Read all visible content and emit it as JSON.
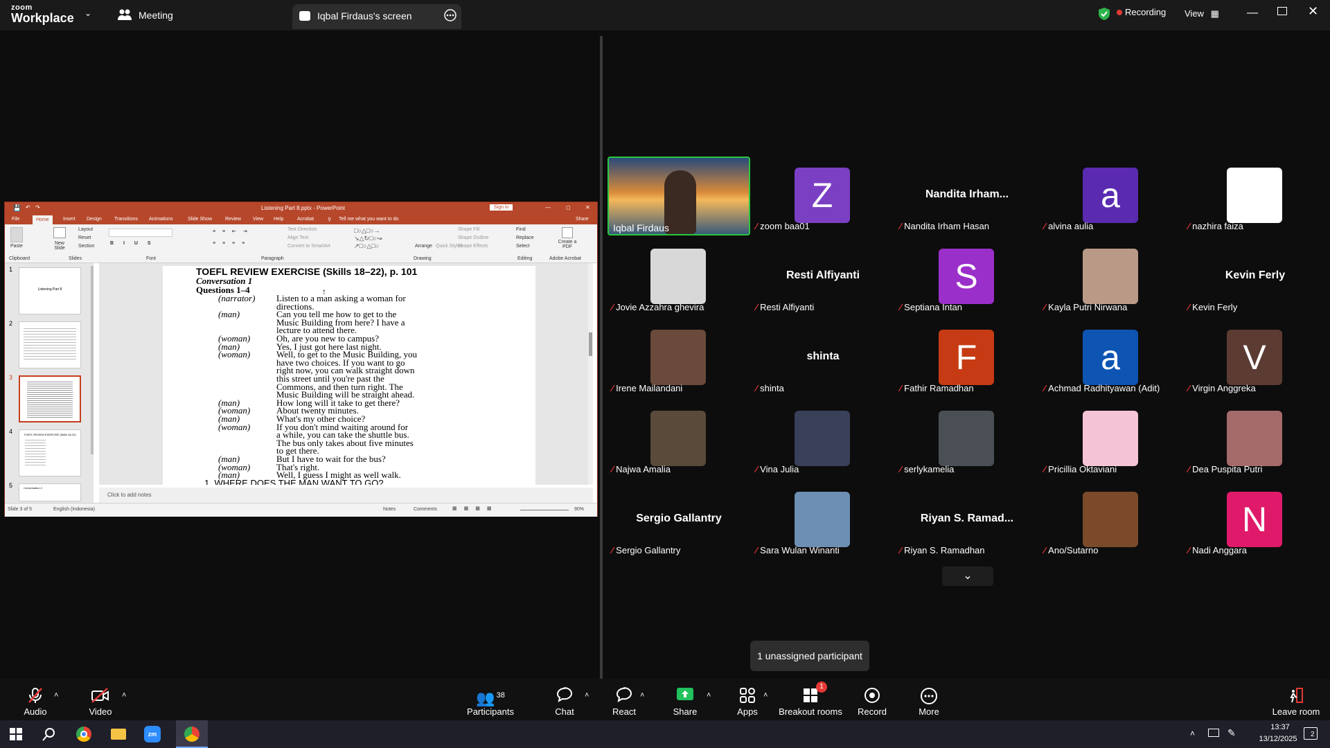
{
  "header": {
    "logo_top": "zoom",
    "logo_bottom": "Workplace",
    "meeting_label": "Meeting",
    "share_tab_label": "Iqbal Firdaus's screen",
    "recording_label": "Recording",
    "view_label": "View",
    "recording_color": "#e53935",
    "shield_color": "#2db34a"
  },
  "ppt": {
    "title": "Listening Part 8.pptx - PowerPoint",
    "sign_in": "Sign in",
    "tabs": [
      "File",
      "Home",
      "Insert",
      "Design",
      "Transitions",
      "Animations",
      "Slide Show",
      "Review",
      "View",
      "Help",
      "Acrobat",
      "Tell me what you want to do"
    ],
    "share": "Share",
    "ribbon": {
      "paste": "Paste",
      "layout": "Layout",
      "reset": "Reset",
      "new_slide": "New Slide",
      "section": "Section",
      "find": "Find",
      "replace": "Replace",
      "select": "Select",
      "create_pdf": "Create a PDF",
      "text_direction": "Text Direction",
      "align_text": "Align Text",
      "convert_smartart": "Convert to SmartArt",
      "shape_fill": "Shape Fill",
      "shape_outline": "Shape Outline",
      "shape_effects": "Shape Effects",
      "arrange": "Arrange",
      "quick_styles": "Quick Styles",
      "groups": [
        "Clipboard",
        "Slides",
        "Font",
        "Paragraph",
        "Drawing",
        "Editing",
        "Adobe Acrobat"
      ]
    },
    "thumbs": [
      {
        "num": "1",
        "text": "Listening Part 8"
      },
      {
        "num": "2",
        "text": ""
      },
      {
        "num": "3",
        "text": ""
      },
      {
        "num": "4",
        "text": "TOEFL REVIEW EXERCISE (Skills 18-22)"
      },
      {
        "num": "5",
        "text": "Conversation 2"
      }
    ],
    "slide": {
      "heading": "TOEFL REVIEW EXERCISE (Skills 18–22), p. 101",
      "sub1": "Conversation 1",
      "sub2": "Questions 1–4",
      "lines": [
        {
          "speaker": "(narrator)",
          "text": "Listen to a man asking a woman for"
        },
        {
          "speaker": "",
          "text": "directions."
        },
        {
          "speaker": "(man)",
          "text": "Can you tell me how to get to the"
        },
        {
          "speaker": "",
          "text": "Music Building from here? I have a"
        },
        {
          "speaker": "",
          "text": "lecture to attend there."
        },
        {
          "speaker": "(woman)",
          "text": "Oh, are you new to campus?"
        },
        {
          "speaker": "(man)",
          "text": "Yes, I just got here last night."
        },
        {
          "speaker": "(woman)",
          "text": "Well, to get to the Music Building, you"
        },
        {
          "speaker": "",
          "text": "have two choices. If you want to go"
        },
        {
          "speaker": "",
          "text": "right now, you can walk straight down"
        },
        {
          "speaker": "",
          "text": "this street until you're past the"
        },
        {
          "speaker": "",
          "text": "Commons, and then turn right. The"
        },
        {
          "speaker": "",
          "text": "Music Building will be straight ahead."
        },
        {
          "speaker": "(man)",
          "text": "How long will it take to get there?"
        },
        {
          "speaker": "(woman)",
          "text": "About twenty minutes."
        },
        {
          "speaker": "(man)",
          "text": "What's my other choice?"
        },
        {
          "speaker": "(woman)",
          "text": "If you don't mind waiting around for"
        },
        {
          "speaker": "",
          "text": "a while, you can take the shuttle bus."
        },
        {
          "speaker": "",
          "text": "The bus only takes about five minutes"
        },
        {
          "speaker": "",
          "text": "to get there."
        },
        {
          "speaker": "(man)",
          "text": "But I have to wait for the bus?"
        },
        {
          "speaker": "(woman)",
          "text": "That's right."
        },
        {
          "speaker": "(man)",
          "text": "Well, I guess I might as well walk."
        },
        {
          "speaker": "",
          "text": "1. WHERE DOES THE MAN WANT TO GO?"
        }
      ]
    },
    "notes_placeholder": "Click to add notes",
    "status": {
      "slide_count": "Slide 3 of 5",
      "language": "English (Indonesia)",
      "notes": "Notes",
      "comments": "Comments",
      "zoom": "90%"
    }
  },
  "gallery": {
    "participants": [
      {
        "name": "Iqbal Firdaus",
        "type": "video",
        "muted": false,
        "active": true
      },
      {
        "name": "zoom baa01",
        "type": "letter",
        "letter": "Z",
        "color": "#7b3fc4",
        "muted": true
      },
      {
        "name": "Nandita Irham Hasan",
        "type": "name",
        "big": "Nandita  Irham...",
        "muted": true
      },
      {
        "name": "alvina aulia",
        "type": "letter",
        "letter": "a",
        "color": "#5a2bb0",
        "muted": true
      },
      {
        "name": "nazhira faiza",
        "type": "blank",
        "color": "#ffffff",
        "muted": true
      },
      {
        "name": "Jovie Azzahra ghevira",
        "type": "photo",
        "color": "#d8d8d8",
        "muted": true
      },
      {
        "name": "Resti Alfiyanti",
        "type": "name",
        "big": "Resti Alfiyanti",
        "muted": true
      },
      {
        "name": "Septiana Intan",
        "type": "letter",
        "letter": "S",
        "color": "#9b2fc9",
        "muted": true
      },
      {
        "name": "Kayla Putri Nirwana",
        "type": "photo",
        "color": "#b99a86",
        "muted": true
      },
      {
        "name": "Kevin Ferly",
        "type": "name",
        "big": "Kevin Ferly",
        "muted": true
      },
      {
        "name": "Irene Mailandani",
        "type": "photo",
        "color": "#6a4a3a",
        "muted": true
      },
      {
        "name": "shinta",
        "type": "name",
        "big": "shinta",
        "muted": true
      },
      {
        "name": "Fathir Ramadhan",
        "type": "letter",
        "letter": "F",
        "color": "#c63b13",
        "muted": true
      },
      {
        "name": "Achmad Radhityawan (Adit)",
        "type": "letter",
        "letter": "a",
        "color": "#0e55b3",
        "muted": true
      },
      {
        "name": "Virgin Anggreka",
        "type": "letter",
        "letter": "V",
        "color": "#5b3b32",
        "muted": true
      },
      {
        "name": "Najwa Amalia",
        "type": "photo",
        "color": "#5a4a3a",
        "muted": true
      },
      {
        "name": "Vina Julia",
        "type": "photo",
        "color": "#3a3f5a",
        "muted": true
      },
      {
        "name": "serlykamelia",
        "type": "photo",
        "color": "#4a4f55",
        "muted": true
      },
      {
        "name": "Pricillia Oktaviani",
        "type": "photo",
        "color": "#f3c4d6",
        "muted": true
      },
      {
        "name": "Dea Puspita Putri",
        "type": "photo",
        "color": "#a56a6a",
        "muted": true
      },
      {
        "name": "Sergio Gallantry",
        "type": "name",
        "big": "Sergio Gallantry",
        "muted": true
      },
      {
        "name": "Sara Wulan Winanti",
        "type": "photo",
        "color": "#6c8fb3",
        "muted": true
      },
      {
        "name": "Riyan S. Ramadhan",
        "type": "name",
        "big": "Riyan S. Ramad...",
        "muted": true
      },
      {
        "name": "Ano/Sutarno",
        "type": "photo",
        "color": "#7a4a2a",
        "muted": true
      },
      {
        "name": "Nadi Anggara",
        "type": "letter",
        "letter": "N",
        "color": "#e01a6a",
        "muted": true
      }
    ],
    "unassigned": "1 unassigned participant"
  },
  "toolbar": {
    "audio": "Audio",
    "video": "Video",
    "participants": "Participants",
    "participants_count": "38",
    "chat": "Chat",
    "react": "React",
    "share": "Share",
    "apps": "Apps",
    "breakout": "Breakout rooms",
    "breakout_badge": "1",
    "record": "Record",
    "more": "More",
    "leave": "Leave room",
    "share_color": "#21c25d",
    "danger_color": "#e53935"
  },
  "taskbar": {
    "time": "13:37",
    "date": "13/12/2025",
    "notif_count": "2"
  }
}
